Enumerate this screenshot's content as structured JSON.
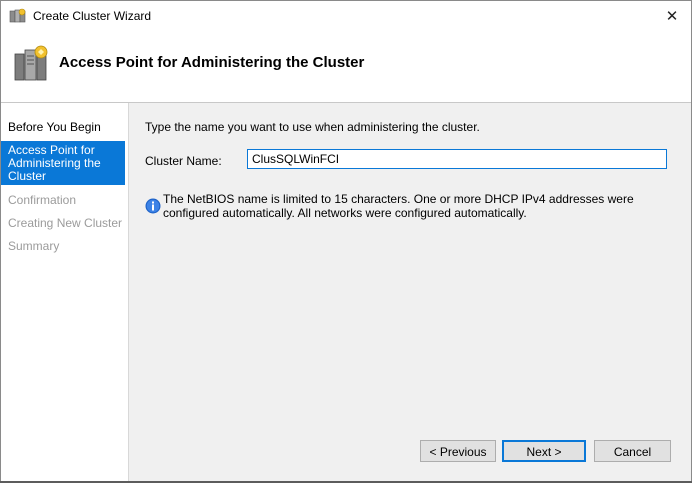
{
  "window": {
    "title": "Create Cluster Wizard",
    "close_glyph": "✕",
    "app_icon": "cluster-server-icon"
  },
  "header": {
    "title": "Access Point for Administering the Cluster",
    "icon": "cluster-server-icon"
  },
  "nav": {
    "items": [
      {
        "label": "Before You Begin",
        "state": "done"
      },
      {
        "label": "Access Point for Administering the Cluster",
        "state": "current"
      },
      {
        "label": "Confirmation",
        "state": "future"
      },
      {
        "label": "Creating New Cluster",
        "state": "future"
      },
      {
        "label": "Summary",
        "state": "future"
      }
    ]
  },
  "content": {
    "prompt": "Type the name you want to use when administering the cluster.",
    "cluster_name_label": "Cluster Name:",
    "cluster_name_value": "ClusSQLWinFCI",
    "info_icon": "info-icon",
    "info_text": "The NetBIOS name is limited to 15 characters.  One or more DHCP IPv4 addresses were configured automatically.  All networks were configured automatically."
  },
  "buttons": {
    "previous": "< Previous",
    "next": "Next >",
    "cancel": "Cancel"
  },
  "colors": {
    "accent": "#0a78d7",
    "content_bg": "#f0f0f0",
    "disabled_text": "#9b9b9b"
  }
}
